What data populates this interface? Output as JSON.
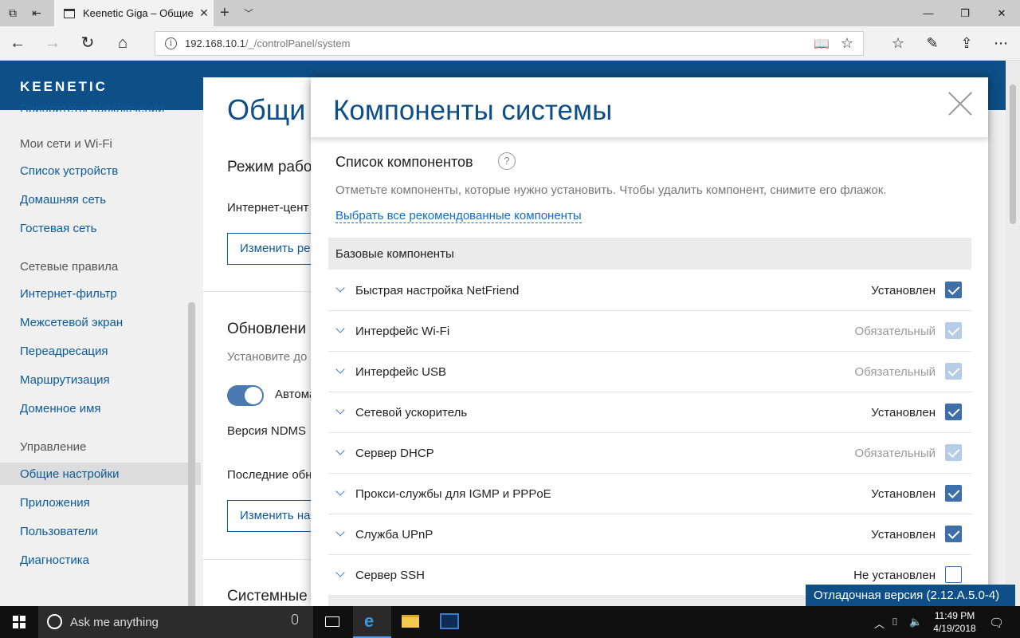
{
  "browser": {
    "tab_title": "Keenetic Giga – Общие",
    "url_host": "192.168.10.1",
    "url_path": "/_/controlPanel/system"
  },
  "brand": {
    "logo": "KEENETIC"
  },
  "sidebar": {
    "cut_item": "Приоритеты подключений",
    "sections": [
      {
        "heading": "Мои сети и Wi-Fi",
        "items": [
          "Список устройств",
          "Домашняя сеть",
          "Гостевая сеть"
        ]
      },
      {
        "heading": "Сетевые правила",
        "items": [
          "Интернет-фильтр",
          "Межсетевой экран",
          "Переадресация",
          "Маршрутизация",
          "Доменное имя"
        ]
      },
      {
        "heading": "Управление",
        "items": [
          "Общие настройки",
          "Приложения",
          "Пользователи",
          "Диагностика"
        ]
      }
    ],
    "active_item": "Общие настройки"
  },
  "content": {
    "title": "Общи",
    "mode_heading": "Режим рабо",
    "mode_text": "Интернет-цент",
    "mode_button": "Изменить ре",
    "update_heading": "Обновлени",
    "update_hint": "Установите до",
    "auto_label": "Автома",
    "ndms_label": "Версия NDMS",
    "last_label": "Последние обн",
    "update_button": "Изменить на",
    "system_heading": "Системные"
  },
  "modal": {
    "title": "Компоненты системы",
    "subtitle": "Список компонентов",
    "help": "?",
    "description": "Отметьте компоненты, которые нужно установить. Чтобы удалить компонент, снимите его флажок.",
    "select_all_link": "Выбрать все рекомендованные компоненты",
    "section": "Базовые компоненты",
    "components": [
      {
        "name": "Быстрая настройка NetFriend",
        "status": "Установлен",
        "state": "checked"
      },
      {
        "name": "Интерфейс Wi-Fi",
        "status": "Обязательный",
        "state": "required"
      },
      {
        "name": "Интерфейс USB",
        "status": "Обязательный",
        "state": "required"
      },
      {
        "name": "Сетевой ускоритель",
        "status": "Установлен",
        "state": "checked"
      },
      {
        "name": "Сервер DHCP",
        "status": "Обязательный",
        "state": "required"
      },
      {
        "name": "Прокси-службы для IGMP и PPPoE",
        "status": "Установлен",
        "state": "checked"
      },
      {
        "name": "Служба UPnP",
        "status": "Установлен",
        "state": "checked"
      },
      {
        "name": "Сервер SSH",
        "status": "Не установлен",
        "state": "unchecked"
      }
    ]
  },
  "debug_badge": "Отладочная версия (2.12.A.5.0-4)",
  "taskbar": {
    "search_placeholder": "Ask me anything",
    "time": "11:49 PM",
    "date": "4/19/2018"
  },
  "colors": {
    "brand": "#0d4f86",
    "link": "#0d6fc7",
    "checkbox": "#3e6fa8"
  }
}
